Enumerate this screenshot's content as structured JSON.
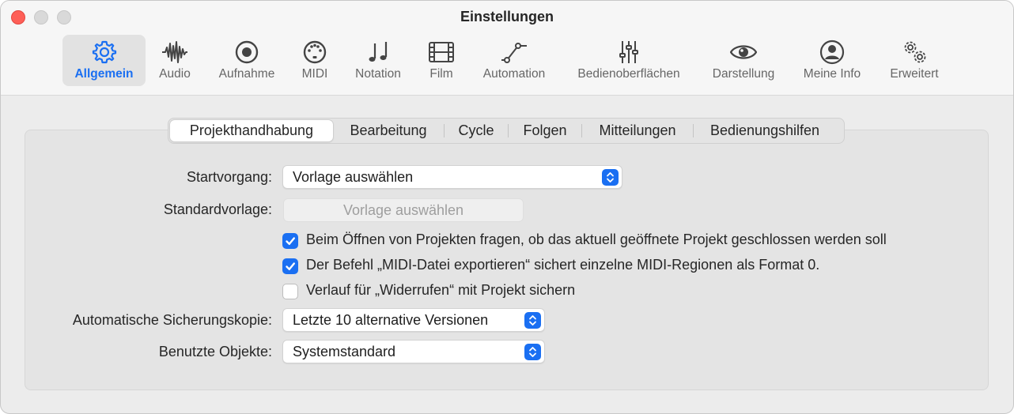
{
  "window": {
    "title": "Einstellungen"
  },
  "toolbar": {
    "items": [
      {
        "label": "Allgemein",
        "icon": "gear-icon",
        "selected": true
      },
      {
        "label": "Audio",
        "icon": "waveform-icon"
      },
      {
        "label": "Aufnahme",
        "icon": "record-icon"
      },
      {
        "label": "MIDI",
        "icon": "midi-port-icon"
      },
      {
        "label": "Notation",
        "icon": "music-notes-icon"
      },
      {
        "label": "Film",
        "icon": "film-icon"
      },
      {
        "label": "Automation",
        "icon": "automation-curve-icon"
      },
      {
        "label": "Bedienoberflächen",
        "icon": "sliders-icon"
      },
      {
        "label": "Darstellung",
        "icon": "eye-icon"
      },
      {
        "label": "Meine Info",
        "icon": "person-icon"
      },
      {
        "label": "Erweitert",
        "icon": "gears-icon"
      }
    ]
  },
  "tabs": [
    {
      "label": "Projekthandhabung",
      "active": true
    },
    {
      "label": "Bearbeitung"
    },
    {
      "label": "Cycle"
    },
    {
      "label": "Folgen"
    },
    {
      "label": "Mitteilungen"
    },
    {
      "label": "Bedienungshilfen"
    }
  ],
  "form": {
    "startup_label": "Startvorgang:",
    "startup_value": "Vorlage auswählen",
    "default_template_label": "Standardvorlage:",
    "default_template_button": "Vorlage auswählen",
    "checkboxes": [
      {
        "label": "Beim Öffnen von Projekten fragen, ob das aktuell geöffnete Projekt geschlossen werden soll",
        "checked": true
      },
      {
        "label": "Der Befehl „MIDI-Datei exportieren“ sichert einzelne MIDI-Regionen als Format 0.",
        "checked": true
      },
      {
        "label": "Verlauf für „Widerrufen“ mit Projekt sichern",
        "checked": false
      }
    ],
    "autosave_label": "Automatische Sicherungskopie:",
    "autosave_value": "Letzte 10 alternative Versionen",
    "objects_label": "Benutzte Objekte:",
    "objects_value": "Systemstandard"
  },
  "colors": {
    "accent": "#1a6ff2",
    "close": "#fe5f57"
  }
}
